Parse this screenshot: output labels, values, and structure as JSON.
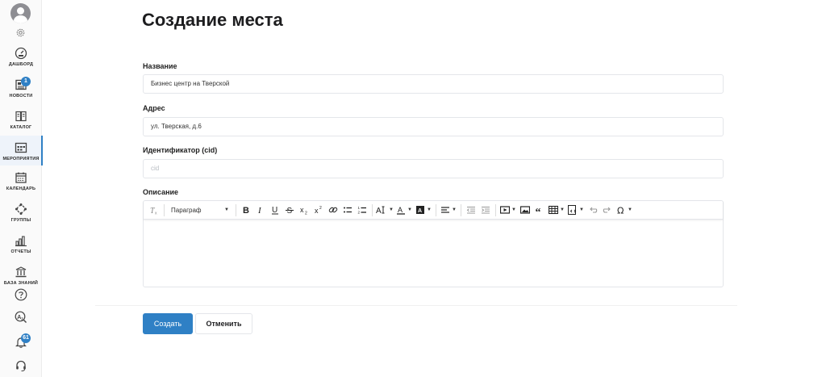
{
  "sidebar": {
    "items": [
      {
        "label": "ДАШБОРД",
        "icon": "dashboard-icon"
      },
      {
        "label": "НОВОСТИ",
        "icon": "news-icon",
        "badge": "1"
      },
      {
        "label": "КАТАЛОГ",
        "icon": "catalog-icon"
      },
      {
        "label": "МЕРОПРИЯТИЯ",
        "icon": "events-icon",
        "active": true
      },
      {
        "label": "КАЛЕНДАРЬ",
        "icon": "calendar-icon"
      },
      {
        "label": "ГРУППЫ",
        "icon": "groups-icon"
      },
      {
        "label": "ОТЧЕТЫ",
        "icon": "reports-icon"
      },
      {
        "label": "БАЗА ЗНАНИЙ",
        "icon": "knowledge-base-icon"
      }
    ],
    "bottom": {
      "help_icon": "help-icon",
      "translate_icon": "translate-icon",
      "notifications_icon": "bell-icon",
      "notifications_badge": "61",
      "support_icon": "headset-icon"
    },
    "accent_color": "#2f80c5"
  },
  "page": {
    "title": "Создание места"
  },
  "form": {
    "name": {
      "label": "Название",
      "value": "Бизнес центр на Тверской"
    },
    "address": {
      "label": "Адрес",
      "value": "ул. Тверская, д.6"
    },
    "cid": {
      "label": "Идентификатор (cid)",
      "placeholder": "cid"
    },
    "description": {
      "label": "Описание",
      "paragraph_format": "Параграф"
    }
  },
  "actions": {
    "create_label": "Создать",
    "cancel_label": "Отменить"
  }
}
